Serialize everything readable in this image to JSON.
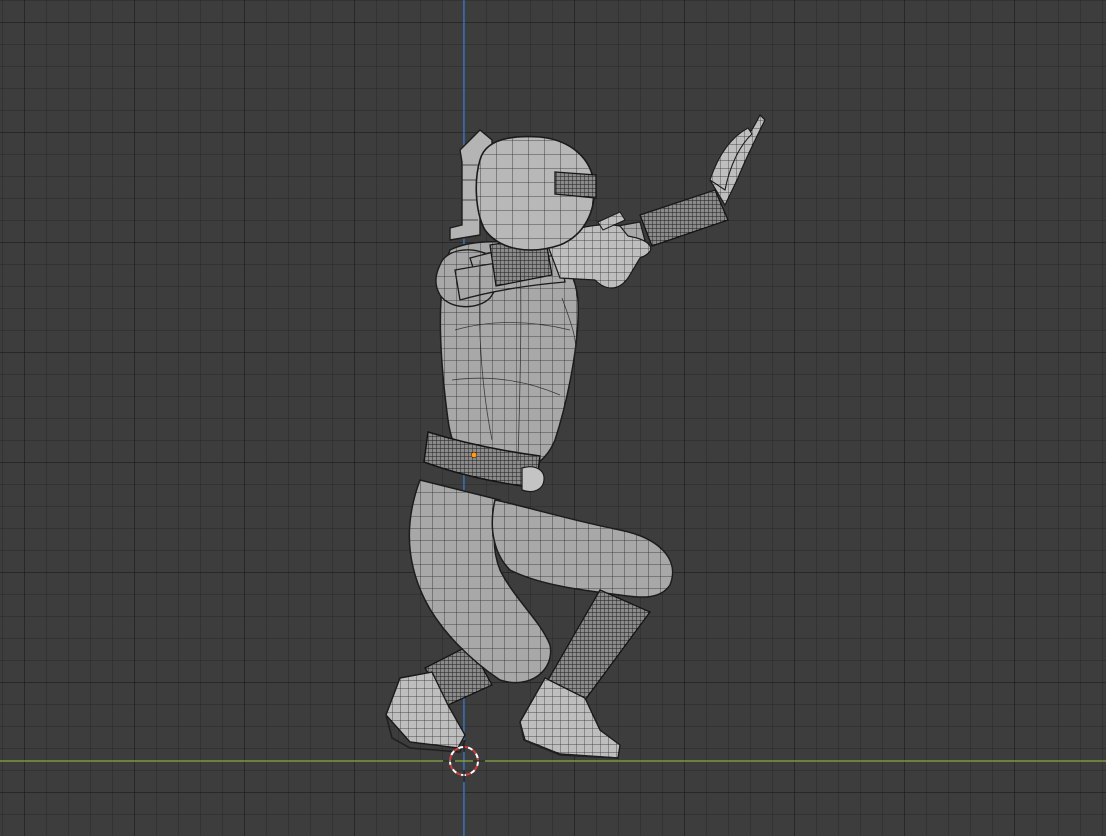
{
  "app": {
    "name": "3D Viewport"
  },
  "viewport": {
    "background": "#3d3d3d",
    "grid_color": "#363636",
    "axis_y_color": "#3f7fd1",
    "axis_x_color": "#8aa840",
    "cursor_color_a": "#d23b3b",
    "cursor_color_b": "#ffffff"
  },
  "scene": {
    "object": "character-mesh",
    "pose": "crouching-reaching",
    "display_mode": "wireframe-overlay",
    "origin_marker_color": "#ff9a1f"
  },
  "icons": {
    "cursor": "3d-cursor-icon",
    "origin": "object-origin-icon"
  }
}
